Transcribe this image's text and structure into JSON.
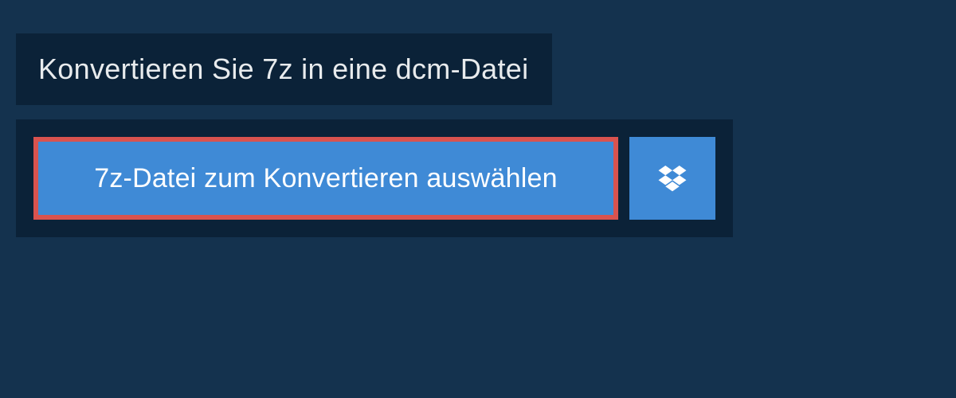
{
  "header": {
    "title": "Konvertieren Sie 7z in eine dcm-Datei"
  },
  "actions": {
    "select_file_label": "7z-Datei zum Konvertieren auswählen",
    "dropbox_icon": "dropbox-icon"
  },
  "colors": {
    "page_bg": "#14324e",
    "panel_bg": "#0b2238",
    "button_bg": "#3f8ad6",
    "highlight_border": "#d9534f",
    "text_light": "#e8ebed",
    "text_white": "#ffffff"
  }
}
